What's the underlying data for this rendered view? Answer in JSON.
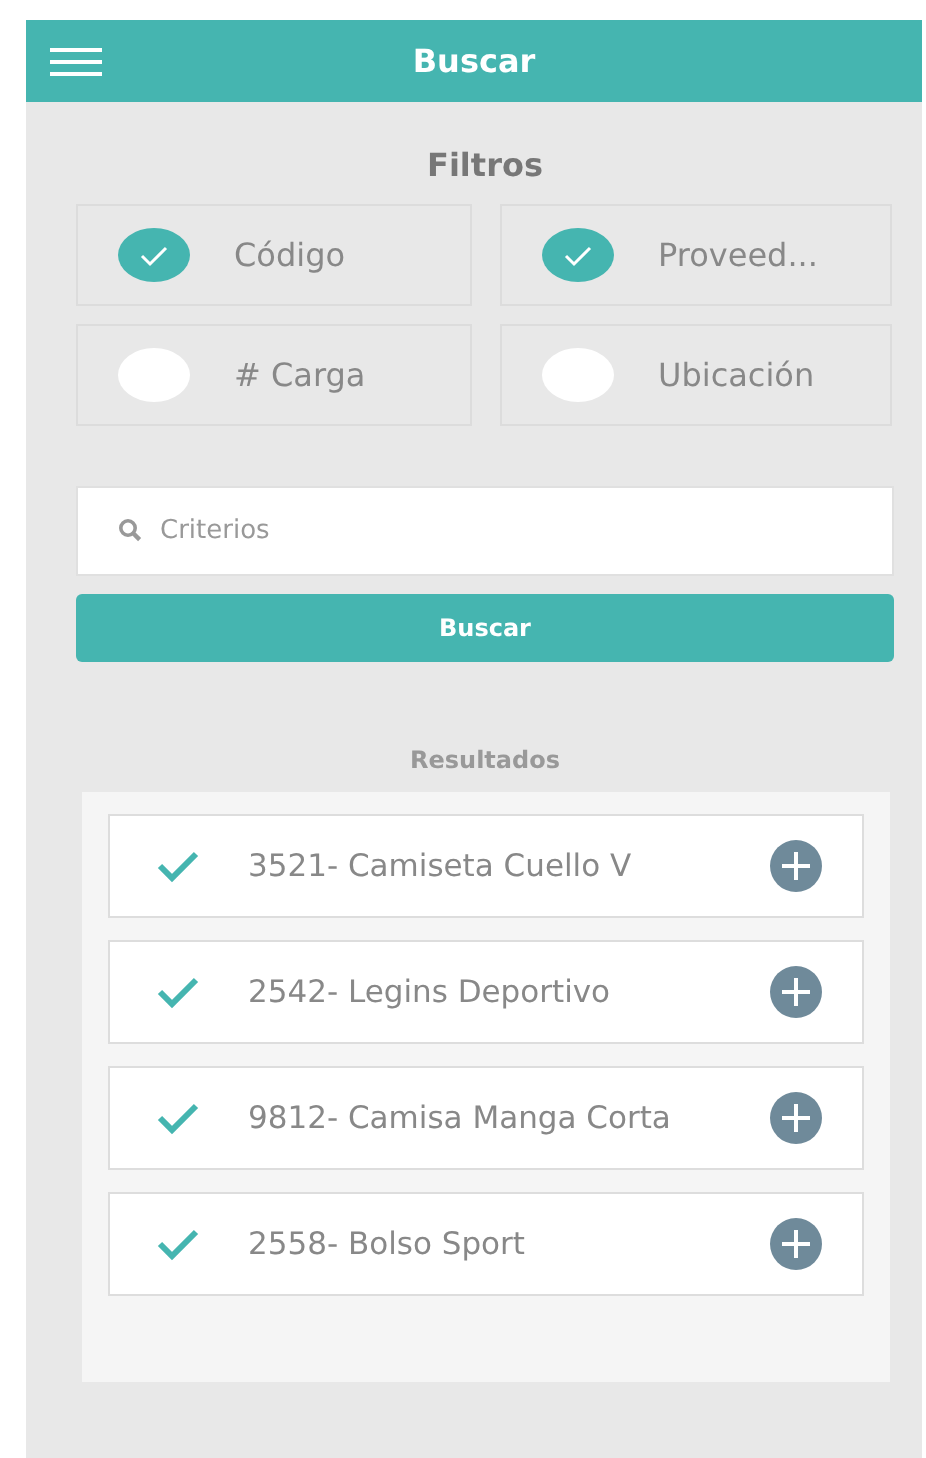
{
  "header": {
    "title": "Buscar"
  },
  "filters": {
    "title": "Filtros",
    "options": [
      {
        "label": "Código",
        "checked": true
      },
      {
        "label": "Proveed...",
        "checked": true
      },
      {
        "label": "# Carga",
        "checked": false
      },
      {
        "label": "Ubicación",
        "checked": false
      }
    ]
  },
  "search": {
    "placeholder": "Criterios",
    "button": "Buscar"
  },
  "results": {
    "title": "Resultados",
    "items": [
      {
        "label": "3521- Camiseta Cuello V",
        "checked": true
      },
      {
        "label": "2542- Legins Deportivo",
        "checked": true
      },
      {
        "label": "9812- Camisa Manga Corta",
        "checked": true
      },
      {
        "label": "2558- Bolso Sport",
        "checked": true
      }
    ]
  }
}
